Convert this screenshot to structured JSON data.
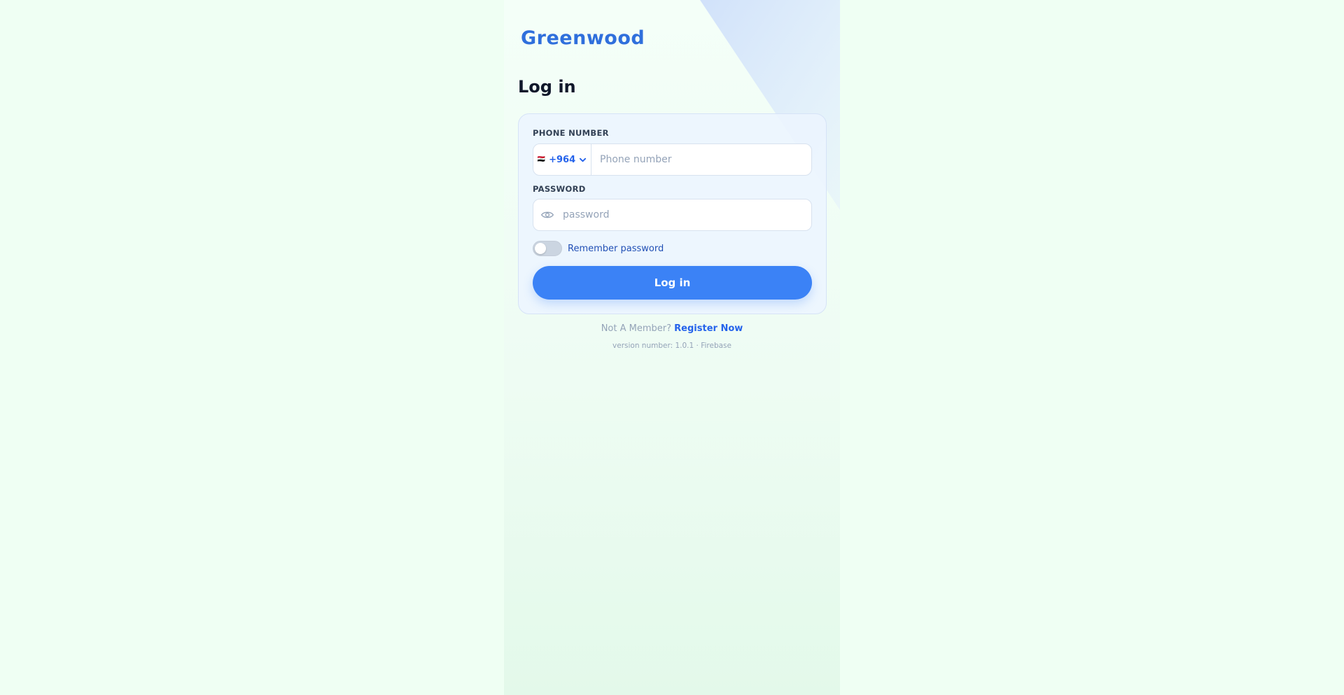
{
  "brand": {
    "name": "Greenwood"
  },
  "page": {
    "title": "Log in"
  },
  "form": {
    "phone_label": "PHONE NUMBER",
    "country_flag": "🇮🇶",
    "country_code": "+964",
    "phone_placeholder": "Phone number",
    "phone_value": "",
    "password_label": "PASSWORD",
    "password_placeholder": "password",
    "password_value": "",
    "remember_label": "Remember password",
    "remember_checked": false,
    "submit_label": "Log in"
  },
  "footer": {
    "register_prompt": "Not A Member?",
    "register_link": "Register Now",
    "version_text": "version number: 1.0.1 · Firebase"
  },
  "colors": {
    "brand": "#2f6fdc",
    "accent": "#3b82f6",
    "page_background": "#effff3"
  },
  "icons": {
    "country_dropdown": "chevron-down-icon",
    "password_visibility": "eye-icon"
  }
}
